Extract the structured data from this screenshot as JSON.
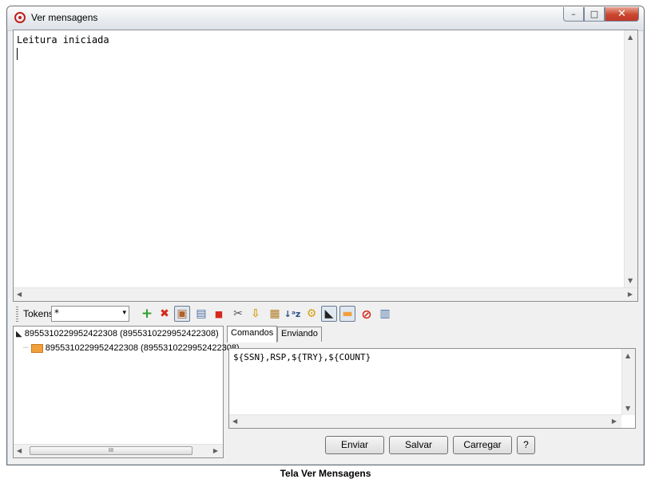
{
  "window": {
    "title": "Ver mensagens",
    "minimize": "–",
    "maximize": "□",
    "close": "✕"
  },
  "messages": {
    "text": "Leitura iniciada"
  },
  "toolbar": {
    "tokens_label": "Tokens",
    "tokens_value": "*",
    "dropdown_glyph": "▾",
    "icons": [
      "add-icon",
      "delete-icon",
      "view-icon",
      "save-icon",
      "stop-icon",
      "tools-icon",
      "import-icon",
      "export-icon",
      "sort-az-icon",
      "filter-icon",
      "receive-icon",
      "send-icon",
      "clear-icon",
      "table-icon"
    ],
    "glyphs": {
      "add": "+",
      "delete": "✖",
      "view": "▣",
      "save": "▤",
      "stop": "■",
      "tools": "✂",
      "import": "⇩",
      "export": "▦",
      "sort": "↓ᵃz",
      "filter": "⚙",
      "receive": "◣",
      "send": "▬",
      "clear": "⊘",
      "table": "▥"
    }
  },
  "tree": {
    "root": "8955310229952422308 (8955310229952422308)",
    "child": "8955310229952422308 (8955310229952422308)",
    "scroll_grip": "III"
  },
  "tabs": {
    "comandos": "Comandos",
    "enviando": "Enviando"
  },
  "command": {
    "text": "${SSN},RSP,${TRY},${COUNT}"
  },
  "buttons": {
    "send": "Enviar",
    "save": "Salvar",
    "load": "Carregar",
    "help": "?"
  },
  "scroll": {
    "up": "▲",
    "down": "▼",
    "left": "◀",
    "right": "▶"
  },
  "caption": "Tela Ver Mensagens",
  "colors": {
    "close_button": "#c9462c",
    "app_icon": "#c0201a",
    "add_icon": "#2ea02e",
    "delete_icon": "#d42a1c",
    "stop_icon": "#d42a1c",
    "send_icon": "#f2a03c"
  }
}
